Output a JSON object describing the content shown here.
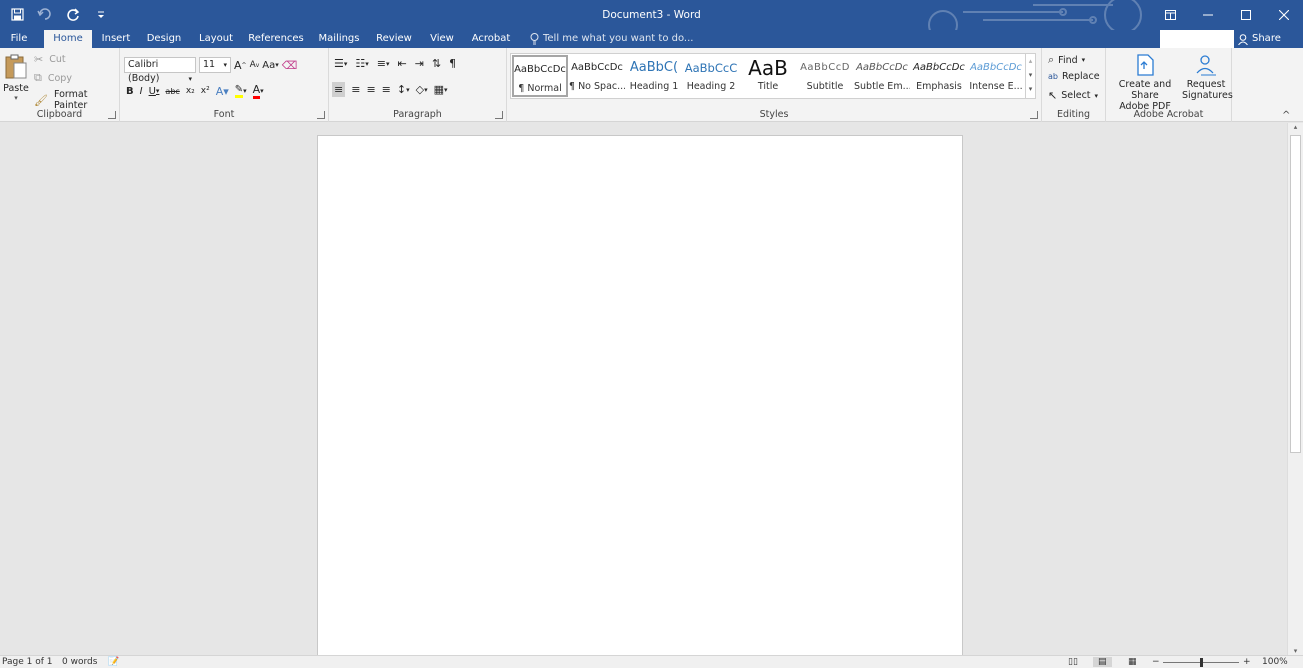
{
  "titlebar": {
    "title": "Document3 - Word",
    "qat": [
      "save-icon",
      "undo-icon",
      "redo-icon",
      "customize-qat-icon"
    ],
    "controls": [
      "ribbon-display-icon",
      "minimize-icon",
      "maximize-icon",
      "close-icon"
    ]
  },
  "tabs": [
    "File",
    "Home",
    "Insert",
    "Design",
    "Layout",
    "References",
    "Mailings",
    "Review",
    "View",
    "Acrobat"
  ],
  "tellme": "Tell me what you want to do...",
  "share": "Share",
  "clipboard": {
    "label": "Clipboard",
    "paste": "Paste",
    "cut": "Cut",
    "copy": "Copy",
    "format_painter": "Format Painter"
  },
  "font": {
    "label": "Font",
    "family": "Calibri (Body)",
    "size": "11",
    "grow": "A",
    "shrink": "A",
    "case": "Aa",
    "bold": "B",
    "italic": "I",
    "underline": "U",
    "strike": "abc",
    "sub": "x₂",
    "sup": "x²"
  },
  "paragraph": {
    "label": "Paragraph",
    "pilcrow": "¶"
  },
  "styles": {
    "label": "Styles",
    "items": [
      {
        "preview": "AaBbCcDc",
        "name": "¶ Normal"
      },
      {
        "preview": "AaBbCcDc",
        "name": "¶ No Spac..."
      },
      {
        "preview": "AaBbC(",
        "name": "Heading 1"
      },
      {
        "preview": "AaBbCcC",
        "name": "Heading 2"
      },
      {
        "preview": "AaB",
        "name": "Title"
      },
      {
        "preview": "AaBbCcD",
        "name": "Subtitle"
      },
      {
        "preview": "AaBbCcDc",
        "name": "Subtle Em..."
      },
      {
        "preview": "AaBbCcDc",
        "name": "Emphasis"
      },
      {
        "preview": "AaBbCcDc",
        "name": "Intense E..."
      }
    ]
  },
  "editing": {
    "label": "Editing",
    "find": "Find",
    "replace": "Replace",
    "select": "Select"
  },
  "acrobat": {
    "label": "Adobe Acrobat",
    "create_line1": "Create and Share",
    "create_line2": "Adobe PDF",
    "request_line1": "Request",
    "request_line2": "Signatures"
  },
  "status": {
    "page": "Page 1 of 1",
    "words": "0 words",
    "zoom": "100%",
    "zoom_level": 1.0
  },
  "colors": {
    "accent": "#2b579a",
    "highlight": "#ffff00",
    "font_color": "#ff0000"
  }
}
